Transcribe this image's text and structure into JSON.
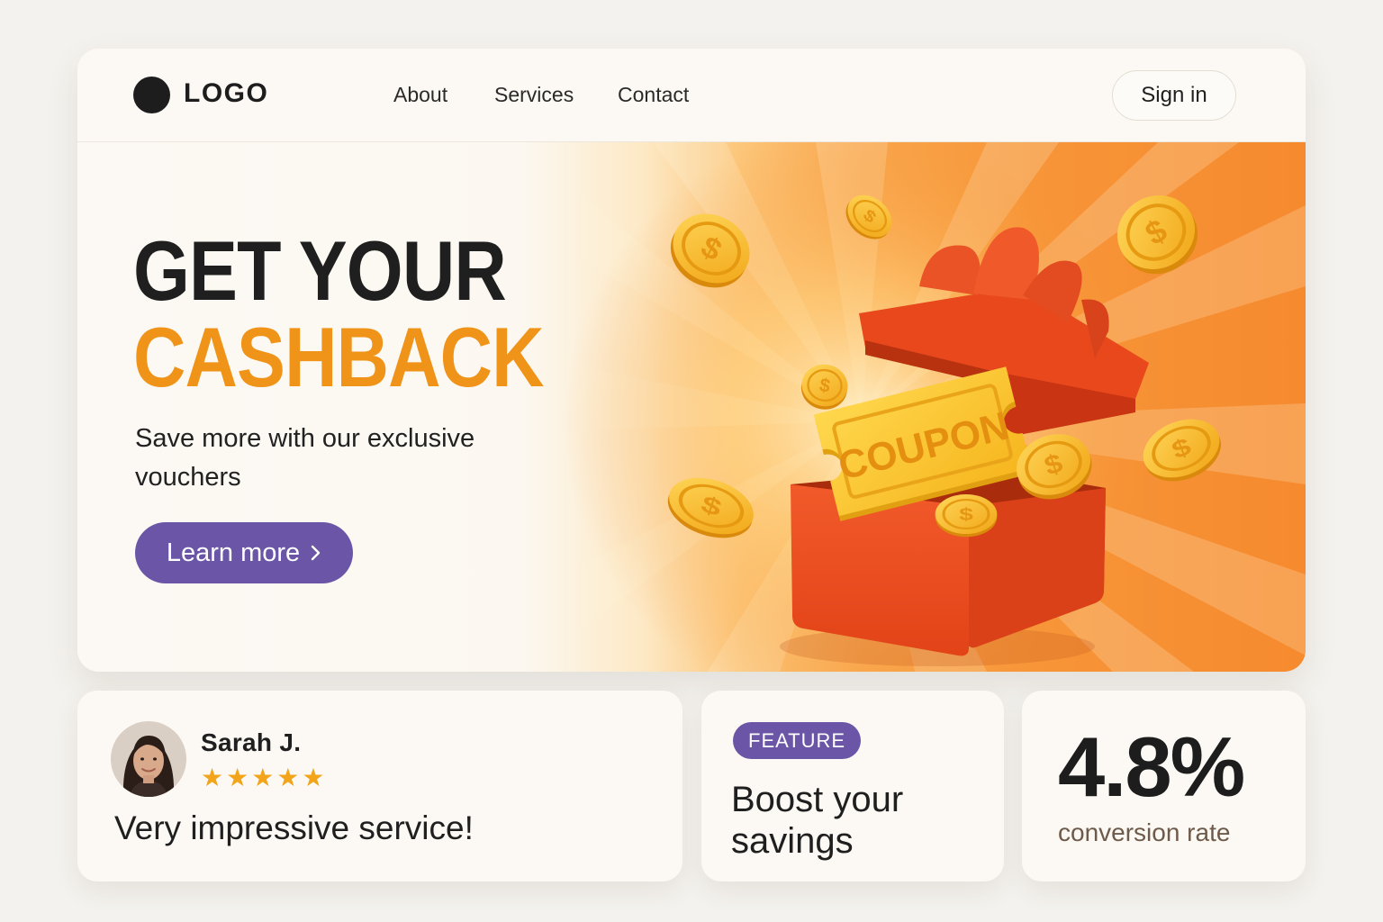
{
  "navbar": {
    "logo_text": "LOGO",
    "links": [
      "About",
      "Services",
      "Contact"
    ],
    "signin_label": "Sign in"
  },
  "hero": {
    "headline_line1": "GET YOUR",
    "headline_line2": "CASHBACK",
    "subtitle": "Save more with our exclusive vouchers",
    "cta_label": "Learn more",
    "cta_icon": "chevron-right-icon",
    "illustration": {
      "coupon_text": "COUPON",
      "coin_symbol": "$"
    }
  },
  "review": {
    "name": "Sarah J.",
    "rating": 5,
    "stars_text": "★★★★★",
    "text": "Very impressive service!"
  },
  "feature": {
    "badge": "FEATURE",
    "title": "Boost your savings"
  },
  "stat": {
    "value": "4.8%",
    "label": "conversion rate"
  },
  "colors": {
    "accent_purple": "#6a55a6",
    "accent_orange": "#ef9419",
    "star_gold": "#f2a51a",
    "box_red": "#ec4a22"
  }
}
